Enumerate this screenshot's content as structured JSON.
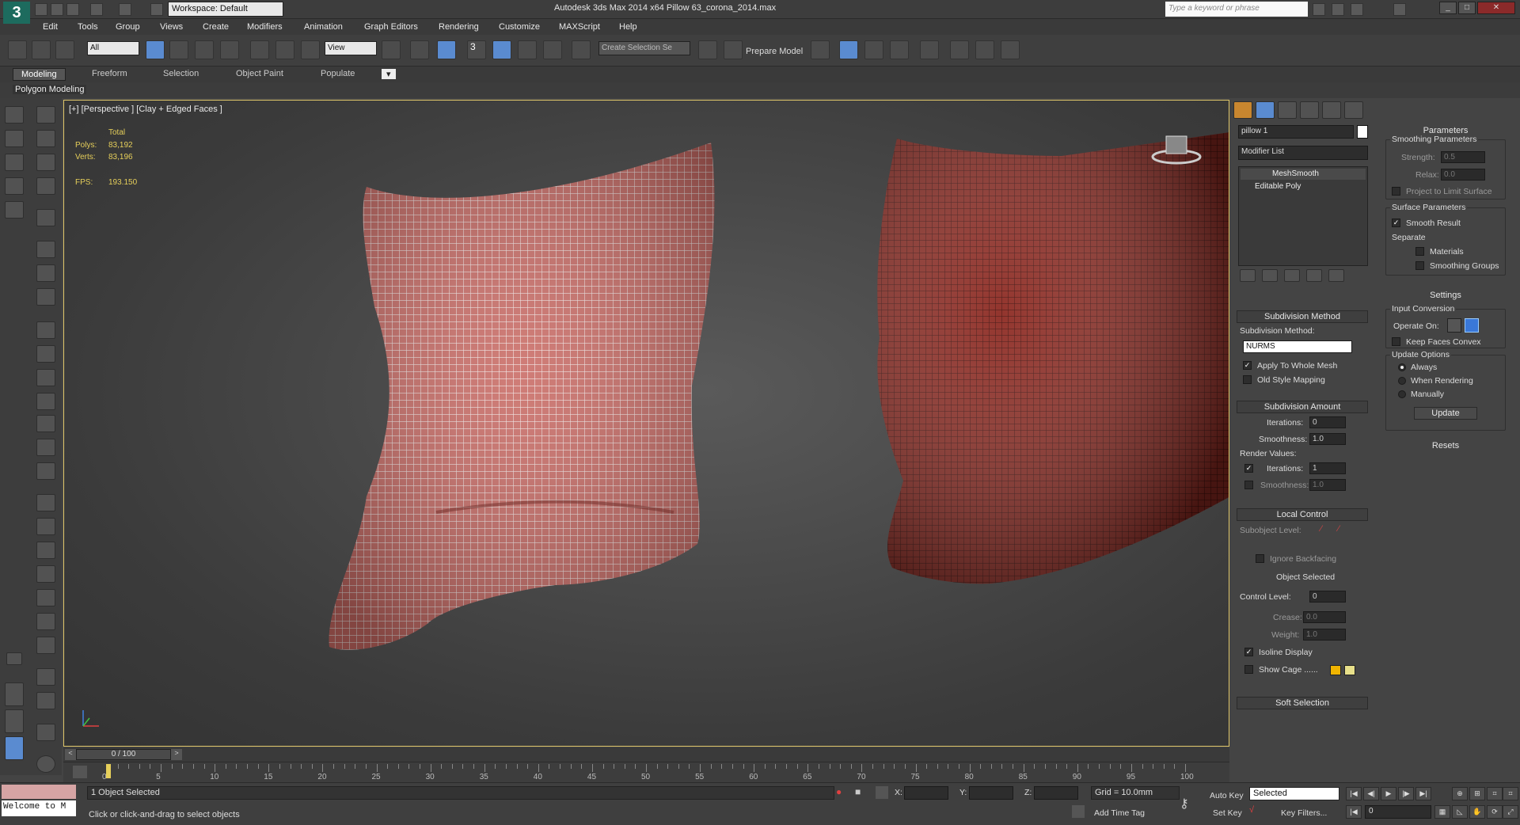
{
  "title_bar": {
    "workspace": "Workspace: Default",
    "app_title": "Autodesk 3ds Max  2014 x64     Pillow 63_corona_2014.max",
    "search_placeholder": "Type a keyword or phrase"
  },
  "menus": [
    "Edit",
    "Tools",
    "Group",
    "Views",
    "Create",
    "Modifiers",
    "Animation",
    "Graph Editors",
    "Rendering",
    "Customize",
    "MAXScript",
    "Help"
  ],
  "toolbar": {
    "filter_value": "All",
    "refcoord_value": "View",
    "selection_set_placeholder": "Create Selection Se",
    "prepare_model": "Prepare Model",
    "snap_label": "3"
  },
  "ribbon": {
    "tabs": [
      "Modeling",
      "Freeform",
      "Selection",
      "Object Paint",
      "Populate"
    ],
    "active_tab": "Modeling",
    "sub_label": "Polygon Modeling"
  },
  "viewport": {
    "label": "[+] [Perspective ] [Clay + Edged Faces ]",
    "stats_total": "Total",
    "polys_label": "Polys:",
    "polys_value": "83,192",
    "verts_label": "Verts:",
    "verts_value": "83,196",
    "fps_label": "FPS:",
    "fps_value": "193.150",
    "pillow_front_color": "#c96a64",
    "pillow_back_color": "#8d2a22",
    "frame_color": "#e0c76a"
  },
  "command_panel": {
    "object_name": "pillow 1",
    "modifier_list": "Modifier List",
    "stack": [
      "MeshSmooth",
      "Editable Poly"
    ],
    "subdivision_method": {
      "title": "Subdivision Method",
      "label": "Subdivision Method:",
      "value": "NURMS",
      "apply_whole": "Apply To Whole Mesh",
      "old_style": "Old Style Mapping"
    },
    "subdivision_amount": {
      "title": "Subdivision Amount",
      "iterations_label": "Iterations:",
      "iterations": "0",
      "smoothness_label": "Smoothness:",
      "smoothness": "1.0",
      "render_values": "Render Values:",
      "r_iterations": "1",
      "r_smoothness": "1.0"
    },
    "local_control": {
      "title": "Local Control",
      "subobject_level": "Subobject Level:",
      "ignore_backfacing": "Ignore Backfacing",
      "object_selected": "Object Selected",
      "control_level_label": "Control Level:",
      "control_level": "0",
      "crease_label": "Crease:",
      "crease": "0.0",
      "weight_label": "Weight:",
      "weight": "1.0",
      "isoline": "Isoline Display",
      "show_cage": "Show Cage ......"
    },
    "soft_selection": "Soft Selection"
  },
  "parameters_panel": {
    "title": "Parameters",
    "smoothing_params": "Smoothing Parameters",
    "strength_label": "Strength:",
    "strength": "0.5",
    "relax_label": "Relax:",
    "relax": "0.0",
    "project_limit": "Project to Limit Surface",
    "surface_params": "Surface Parameters",
    "smooth_result": "Smooth Result",
    "separate": "Separate",
    "materials": "Materials",
    "smoothing_groups": "Smoothing Groups",
    "settings": "Settings",
    "input_conversion": "Input Conversion",
    "operate_on": "Operate On:",
    "keep_faces_convex": "Keep Faces Convex",
    "update_options": "Update Options",
    "always": "Always",
    "when_rendering": "When Rendering",
    "manually": "Manually",
    "update_btn": "Update",
    "resets": "Resets"
  },
  "timeline": {
    "frame_counter": "0 / 100",
    "ticks": [
      "0",
      "5",
      "10",
      "15",
      "20",
      "25",
      "30",
      "35",
      "40",
      "45",
      "50",
      "55",
      "60",
      "65",
      "70",
      "75",
      "80",
      "85",
      "90",
      "95",
      "100"
    ]
  },
  "status": {
    "welcome": "Welcome to M",
    "selected": "1 Object Selected",
    "prompt": "Click or click-and-drag to select objects",
    "x_label": "X:",
    "y_label": "Y:",
    "z_label": "Z:",
    "grid": "Grid = 10.0mm",
    "add_time_tag": "Add Time Tag",
    "auto_key": "Auto Key",
    "set_key": "Set Key",
    "key_mode": "Selected",
    "key_filters": "Key Filters...",
    "frame": "0"
  }
}
